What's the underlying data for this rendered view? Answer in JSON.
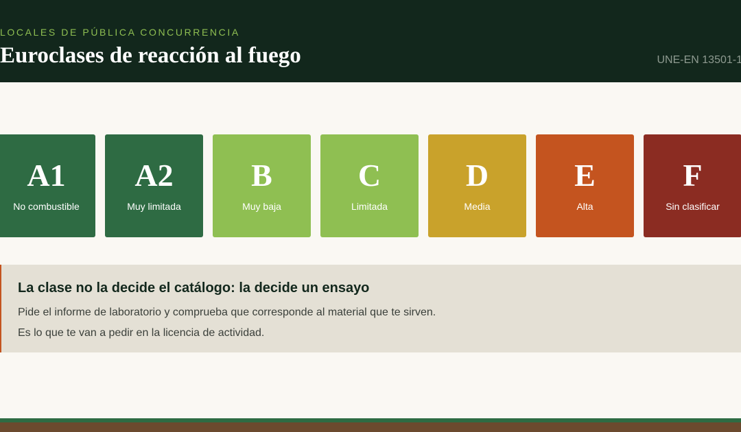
{
  "header": {
    "kicker": "LOCALES DE PÚBLICA CONCURRENCIA",
    "title": "Euroclases de reacción al fuego",
    "norm": "UNE-EN 13501-1"
  },
  "classes": [
    {
      "letter": "A1",
      "label": "No combustible",
      "color": "#2e6b43"
    },
    {
      "letter": "A2",
      "label": "Muy limitada",
      "color": "#2e6b43"
    },
    {
      "letter": "B",
      "label": "Muy baja",
      "color": "#8fbf52"
    },
    {
      "letter": "C",
      "label": "Limitada",
      "color": "#8fbf52"
    },
    {
      "letter": "D",
      "label": "Media",
      "color": "#c9a22b"
    },
    {
      "letter": "E",
      "label": "Alta",
      "color": "#c4541f"
    },
    {
      "letter": "F",
      "label": "Sin clasificar",
      "color": "#8b2c22"
    }
  ],
  "notice": {
    "title": "La clase no la decide el catálogo: la decide un ensayo",
    "line1": "Pide el informe de laboratorio y comprueba que corresponde al material que te sirven.",
    "line2": "Es lo que te van a pedir en la licencia de actividad."
  },
  "colors": {
    "header_bg": "#12271c",
    "accent_green": "#8fbf52",
    "notice_border": "#c4541f",
    "footer_green": "#2e6b43",
    "footer_brown": "#6b4a2e"
  }
}
